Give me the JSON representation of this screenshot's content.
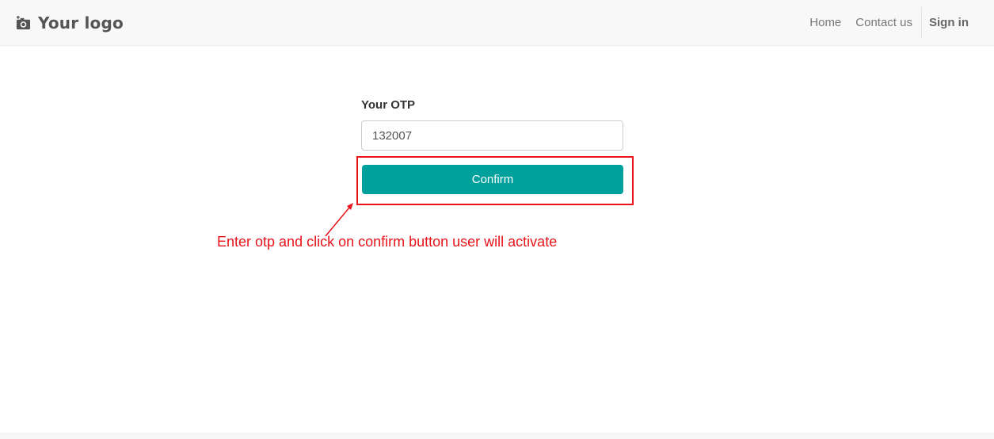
{
  "header": {
    "brand": {
      "text": "Your logo",
      "icon": "camera-icon"
    },
    "nav": {
      "home": "Home",
      "contact": "Contact us",
      "signin": "Sign in"
    }
  },
  "form": {
    "otp_label": "Your OTP",
    "otp_value": "132007",
    "confirm_label": "Confirm"
  },
  "annotation": {
    "text": "Enter otp and click on confirm button user will activate"
  },
  "colors": {
    "accent": "#00a09d",
    "annotation": "#e8141a",
    "navbar_bg": "#f8f8f8"
  }
}
